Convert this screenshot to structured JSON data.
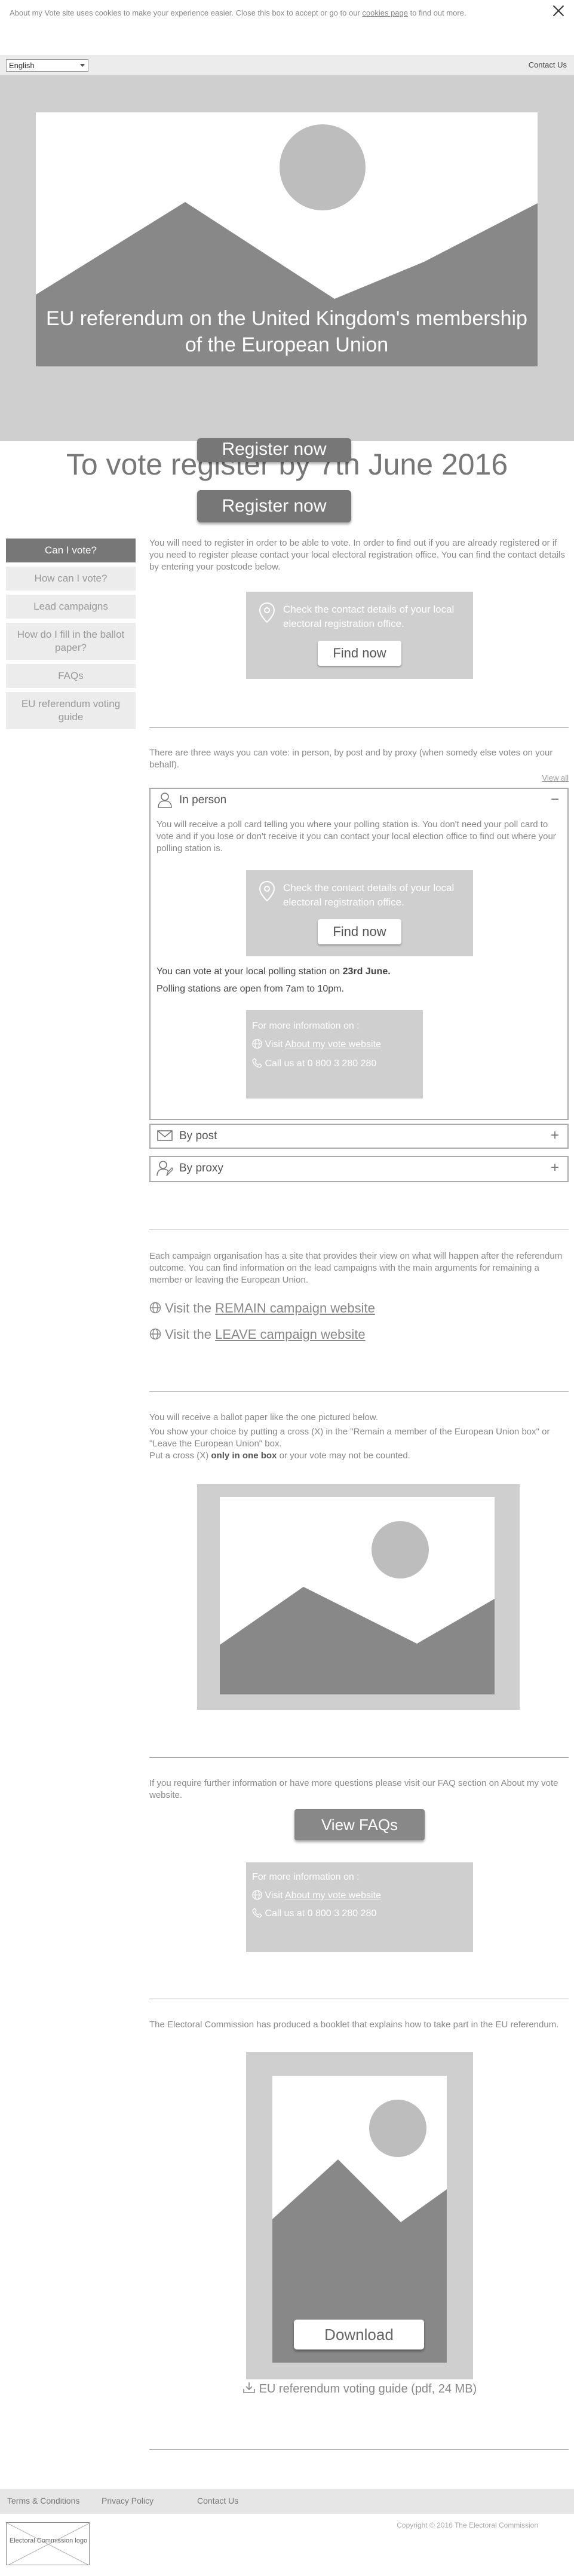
{
  "cookie": {
    "text": "About my Vote site uses cookies to make your experience easier. Close this box to accept or go to our",
    "link": "cookies page",
    "suffix": "to find out more."
  },
  "topbar": {
    "language": "English",
    "contact": "Contact Us"
  },
  "hero": {
    "title": "EU referendum on the United Kingdom's membership of the European Union"
  },
  "headline": {
    "text": "To vote register by 7th June 2016",
    "register_button": "Register now",
    "register_button_2": "Register now"
  },
  "sidenav": {
    "items": [
      {
        "label": "Can I vote?"
      },
      {
        "label": "How can I vote?"
      },
      {
        "label": "Lead campaigns"
      },
      {
        "label": "How do I fill in the ballot paper?"
      },
      {
        "label": "FAQs"
      },
      {
        "label": "EU referendum voting guide"
      }
    ]
  },
  "can_vote": {
    "text": "You will need to register in order to be able to vote. In order to find out if you are already registered or if you need to register please contact your local electoral registration office. You can find the contact details by entering your postcode below.",
    "finder_text": "Check the contact details of your local electoral registration office.",
    "find_button": "Find now"
  },
  "how_vote": {
    "intro": "There are three ways you can vote: in person, by post and by proxy (when somedy else votes on your behalf).",
    "view_all": "View all",
    "in_person": {
      "label": "In person",
      "toggle": "−",
      "text": "You will receive a poll card telling you where your polling station is. You don't need your poll card to vote and if you lose or don't receive it you can contact your local election office to find out where your polling station is.",
      "finder_text": "Check the contact details of your local electoral registration office.",
      "find_button": "Find now",
      "vote_prefix": "You can vote at your local polling station on",
      "vote_date": "23rd June.",
      "hours": "Polling stations are open from 7am to 10pm.",
      "info_heading": "For more information on :",
      "visit_prefix": "Visit",
      "visit_link": "About my vote website",
      "call": "Call us at 0 800 3 280 280"
    },
    "by_post": {
      "label": "By post",
      "toggle": "+"
    },
    "by_proxy": {
      "label": "By proxy",
      "toggle": "+"
    }
  },
  "campaigns": {
    "text": "Each campaign organisation has a site that provides their view on what will happen after the referendum outcome. You can find information on the lead campaigns with the main arguments for remaining a member or leaving the European Union.",
    "remain_prefix": "Visit the",
    "remain_link": "REMAIN campaign website",
    "leave_prefix": "Visit the",
    "leave_link": "LEAVE campaign website"
  },
  "ballot": {
    "line1": "You will receive a ballot paper  like the one pictured below.",
    "line2": "You show your choice by putting a cross (X) in the \"Remain a member of the European Union box\" or \"Leave the European Union\" box.",
    "line3_prefix": "Put a cross (X)",
    "line3_bold": "only in one box",
    "line3_suffix": "or your vote may not be counted."
  },
  "faqs": {
    "text": "If you require further information or have more questions please visit our FAQ section on About my vote website.",
    "button": "View FAQs",
    "info_heading": "For more information on :",
    "visit_prefix": "Visit",
    "visit_link": "About my vote website",
    "call": "Call us at 0 800 3 280 280"
  },
  "guide": {
    "text": "The Electoral Commission has produced a booklet that explains how to take part in the EU referendum.",
    "download": "Download",
    "link": "EU referendum voting guide (pdf, 24 MB)"
  },
  "footer": {
    "links": [
      "Terms & Conditions",
      "Privacy Policy",
      "Contact Us"
    ],
    "logo": "Electoral Commission logo",
    "copyright": "Copyright © 2016 The Electoral Commission"
  },
  "colors": {
    "dark_gray": "#777777",
    "placeholder_gray": "#cfcfcf",
    "image_gray": "#888888"
  }
}
